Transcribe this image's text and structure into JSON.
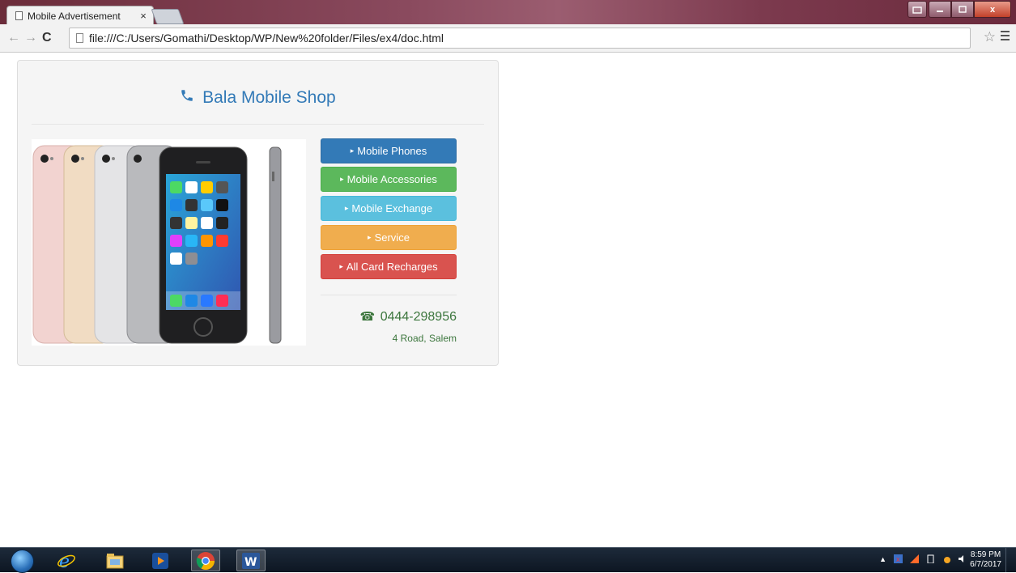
{
  "browser": {
    "tab_title": "Mobile Advertisement",
    "tab_close": "×",
    "address": "file:///C:/Users/Gomathi/Desktop/WP/New%20folder/Files/ex4/doc.html",
    "back": "←",
    "forward": "→",
    "reload": "C",
    "star": "☆",
    "window_close": "x"
  },
  "page": {
    "shop_name": "Bala Mobile Shop",
    "phone_glyph": "📞",
    "buttons": [
      {
        "label": "Mobile Phones"
      },
      {
        "label": "Mobile Accessories"
      },
      {
        "label": "Mobile Exchange"
      },
      {
        "label": "Service"
      },
      {
        "label": "All Card Recharges"
      }
    ],
    "caret": "▸",
    "contact": {
      "phone": "0444-298956",
      "tel_glyph": "☎",
      "address": "4 Road, Salem"
    }
  },
  "taskbar": {
    "time": "8:59 PM",
    "date": "6/7/2017",
    "apps": [
      "internet-explorer-icon",
      "file-explorer-icon",
      "media-player-icon",
      "chrome-icon",
      "word-icon"
    ]
  },
  "colors": {
    "primary": "#337ab7",
    "success": "#5cb85c",
    "info": "#5bc0de",
    "warning": "#f0ad4e",
    "danger": "#d9534f",
    "contact_text": "#3c763d"
  }
}
